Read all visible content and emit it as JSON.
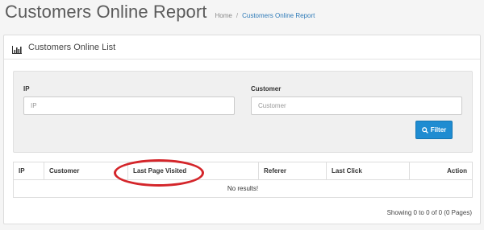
{
  "header": {
    "title": "Customers Online Report",
    "breadcrumb": [
      {
        "label": "Home",
        "active": false
      },
      {
        "label": "Customers Online Report",
        "active": true
      }
    ]
  },
  "panel": {
    "title": "Customers Online List",
    "icon": "bar-chart-icon"
  },
  "filter": {
    "ip_label": "IP",
    "ip_placeholder": "IP",
    "customer_label": "Customer",
    "customer_placeholder": "Customer",
    "button_label": "Filter",
    "button_icon": "search-icon"
  },
  "table": {
    "columns": [
      "IP",
      "Customer",
      "Last Page Visited",
      "Referer",
      "Last Click",
      "Action"
    ],
    "empty_message": "No results!"
  },
  "pagination": {
    "summary": "Showing 0 to 0 of 0 (0 Pages)"
  },
  "colors": {
    "accent": "#1f8cd1",
    "link": "#2f7bb8",
    "highlight": "#d4252a"
  }
}
